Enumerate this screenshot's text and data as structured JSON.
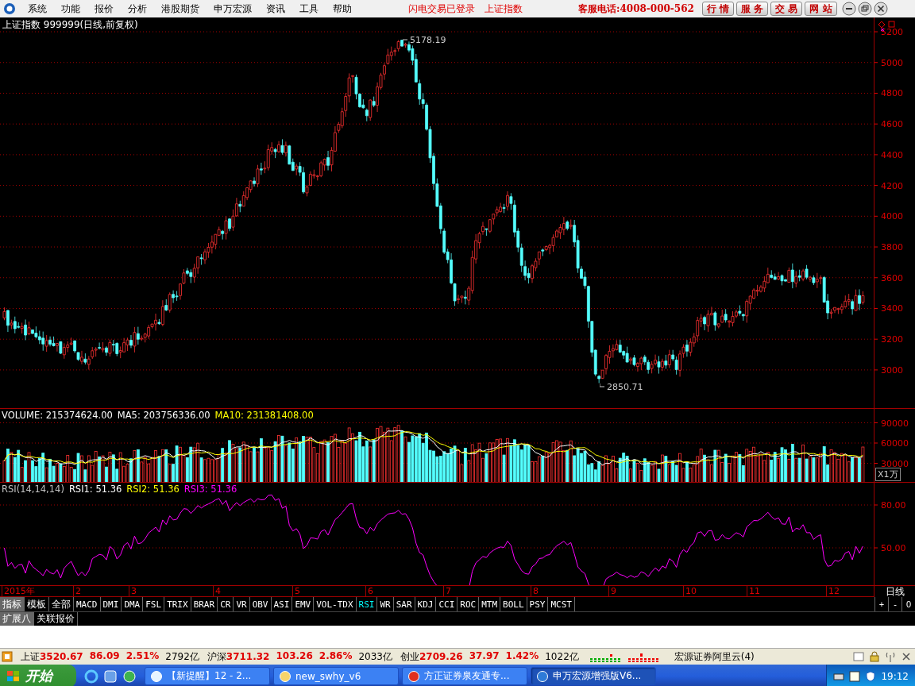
{
  "menu_bar": {
    "items": [
      "系统",
      "功能",
      "报价",
      "分析",
      "港股期货",
      "申万宏源",
      "资讯",
      "工具",
      "帮助"
    ],
    "notices": [
      "闪电交易已登录",
      "上证指数"
    ],
    "hotline": "客服电话:4008-000-562",
    "buttons": [
      "行 情",
      "服 务",
      "交 易",
      "网 站"
    ]
  },
  "price_chart": {
    "title": "上证指数 999999(日线,前复权)",
    "y_labels": [
      "5200",
      "5000",
      "4800",
      "4600",
      "4400",
      "4200",
      "4000",
      "3800",
      "3600",
      "3400",
      "3200",
      "3000"
    ],
    "high_marker": "5178.19",
    "low_marker": "2850.71"
  },
  "volume_panel": {
    "legend": [
      {
        "text": "VOLUME: 215374624.00",
        "color": "#ffffff"
      },
      {
        "text": "MA5: 203756336.00",
        "color": "#ffffff"
      },
      {
        "text": "MA10: 231381408.00",
        "color": "#ffff00"
      }
    ],
    "y_labels": [
      "90000",
      "60000",
      "30000"
    ],
    "unit": "X1万"
  },
  "rsi_panel": {
    "legend": [
      {
        "text": "RSI(14,14,14)",
        "color": "#c0c0c0"
      },
      {
        "text": "RSI1: 51.36",
        "color": "#ffffff"
      },
      {
        "text": "RSI2: 51.36",
        "color": "#ffff00"
      },
      {
        "text": "RSI3: 51.36",
        "color": "#ff00ff"
      }
    ],
    "y_labels": [
      "80.00",
      "50.00"
    ]
  },
  "date_axis": {
    "labels": [
      "2015年",
      "2",
      "3",
      "4",
      "5",
      "6",
      "7",
      "8",
      "9",
      "10",
      "11",
      "12"
    ],
    "period": "日线"
  },
  "view_tabs": [
    {
      "label": "指标",
      "selected": true
    },
    {
      "label": "模板",
      "selected": false
    },
    {
      "label": "全部",
      "selected": false
    }
  ],
  "indicator_tabs": [
    {
      "label": "MACD",
      "selected": false
    },
    {
      "label": "DMI",
      "selected": false
    },
    {
      "label": "DMA",
      "selected": false
    },
    {
      "label": "FSL",
      "selected": false
    },
    {
      "label": "TRIX",
      "selected": false
    },
    {
      "label": "BRAR",
      "selected": false
    },
    {
      "label": "CR",
      "selected": false
    },
    {
      "label": "VR",
      "selected": false
    },
    {
      "label": "OBV",
      "selected": false
    },
    {
      "label": "ASI",
      "selected": false
    },
    {
      "label": "EMV",
      "selected": false
    },
    {
      "label": "VOL-TDX",
      "selected": false
    },
    {
      "label": "RSI",
      "selected": true
    },
    {
      "label": "WR",
      "selected": false
    },
    {
      "label": "SAR",
      "selected": false
    },
    {
      "label": "KDJ",
      "selected": false
    },
    {
      "label": "CCI",
      "selected": false
    },
    {
      "label": "ROC",
      "selected": false
    },
    {
      "label": "MTM",
      "selected": false
    },
    {
      "label": "BOLL",
      "selected": false
    },
    {
      "label": "PSY",
      "selected": false
    },
    {
      "label": "MCST",
      "selected": false
    }
  ],
  "zoom_buttons": [
    "+",
    "-",
    "0"
  ],
  "panel_tabs": [
    {
      "label": "扩展八",
      "selected": true
    },
    {
      "label": "关联报价",
      "selected": false
    }
  ],
  "status_bar": {
    "indices": [
      {
        "name": "上证",
        "value": "3520.67",
        "change": "86.09",
        "percent": "2.51%",
        "amount": "2792亿"
      },
      {
        "name": "沪深",
        "value": "3711.32",
        "change": "103.26",
        "percent": "2.86%",
        "amount": "2033亿"
      },
      {
        "name": "创业",
        "value": "2709.26",
        "change": "37.97",
        "percent": "1.42%",
        "amount": "1022亿"
      }
    ],
    "server": "宏源证券阿里云(4)"
  },
  "taskbar": {
    "start": "开始",
    "tasks": [
      {
        "label": "【新提醒】12 - 2...",
        "selected": false
      },
      {
        "label": "new_swhy_v6",
        "selected": false
      },
      {
        "label": "方正证券泉友通专...",
        "selected": false
      },
      {
        "label": "申万宏源增强版V6...",
        "selected": true
      }
    ],
    "clock": "19:12"
  }
}
